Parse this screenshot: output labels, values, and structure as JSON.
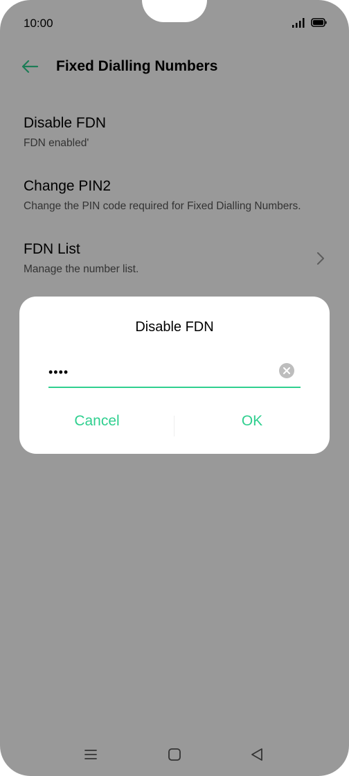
{
  "status_bar": {
    "time": "10:00"
  },
  "header": {
    "title": "Fixed Dialling Numbers"
  },
  "settings": [
    {
      "title": "Disable FDN",
      "subtitle": "FDN enabled'"
    },
    {
      "title": "Change PIN2",
      "subtitle": "Change the PIN code required for Fixed Dialling Numbers."
    },
    {
      "title": "FDN List",
      "subtitle": "Manage the number list."
    }
  ],
  "dialog": {
    "title": "Disable FDN",
    "input_value": "••••",
    "cancel_label": "Cancel",
    "ok_label": "OK"
  },
  "colors": {
    "accent": "#2fcf8f",
    "scrim": "rgba(0,0,0,0.40)"
  },
  "icons": [
    "back-arrow-icon",
    "signal-icon",
    "battery-icon",
    "chevron-right-icon",
    "clear-icon",
    "menu-icon",
    "home-icon",
    "back-icon"
  ]
}
